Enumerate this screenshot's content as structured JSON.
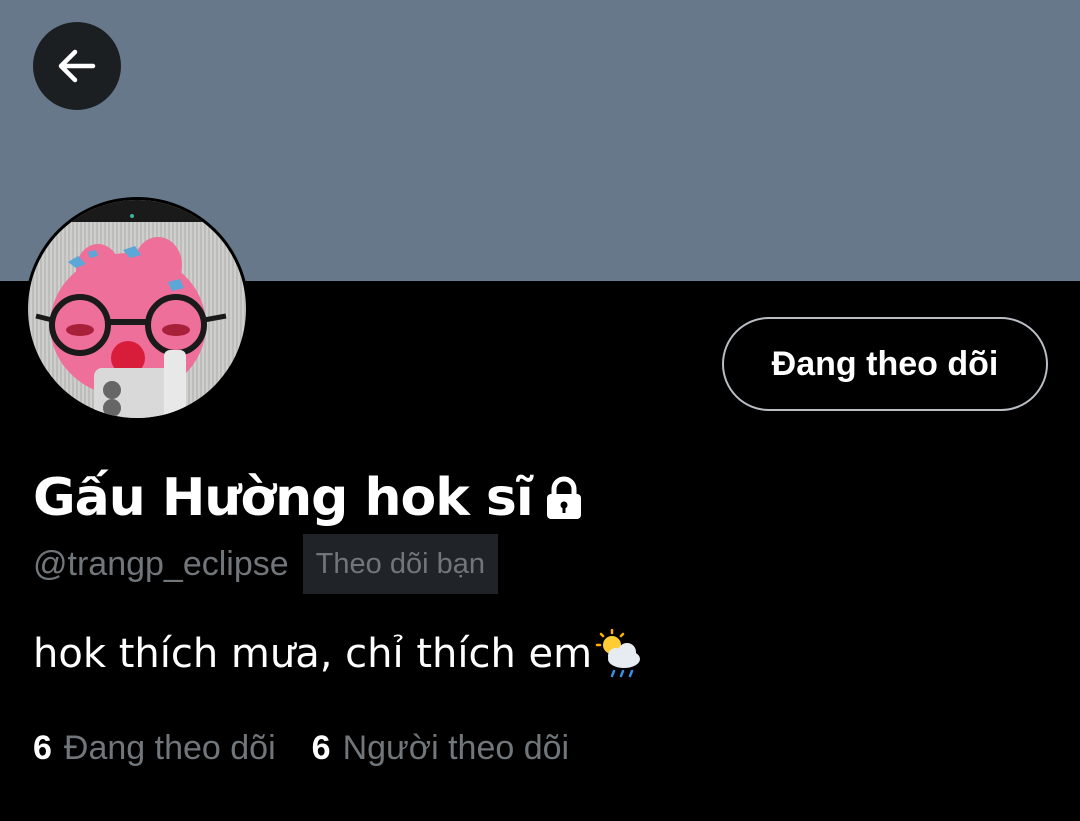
{
  "profile": {
    "display_name": "Gấu Hường hok sĩ",
    "handle": "@trangp_eclipse",
    "follows_you_badge": "Theo dõi bạn",
    "bio": "hok thích mưa, chỉ thích em",
    "protected": true
  },
  "actions": {
    "follow_button_label": "Đang theo dõi"
  },
  "stats": {
    "following_count": "6",
    "following_label": "Đang theo dõi",
    "followers_count": "6",
    "followers_label": "Người theo dõi"
  },
  "icons": {
    "back": "arrow-left-icon",
    "lock": "lock-icon",
    "bio_emoji": "sun-behind-rain-cloud-icon"
  },
  "colors": {
    "banner": "#66788a",
    "background": "#000000",
    "secondary_text": "#71767b",
    "badge_background": "#202327"
  }
}
